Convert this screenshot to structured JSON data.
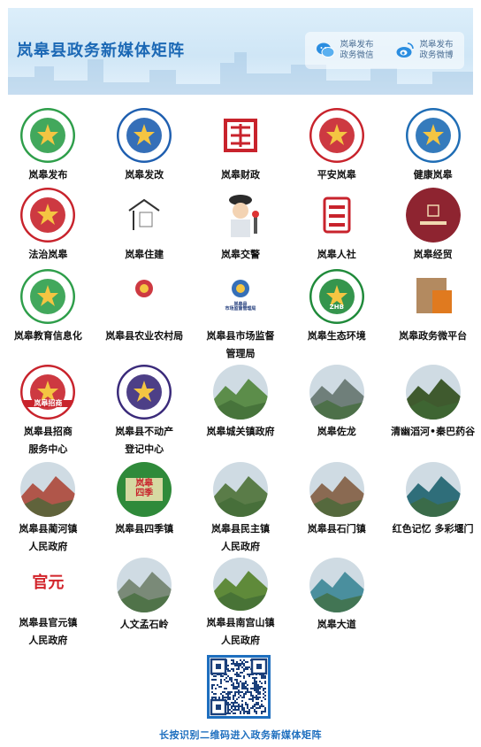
{
  "header": {
    "title": "岚皋县政务新媒体矩阵",
    "links": [
      {
        "line1": "岚皋发布",
        "line2": "政务微信",
        "icon": "wechat-icon"
      },
      {
        "line1": "岚皋发布",
        "line2": "政务微博",
        "icon": "weibo-icon"
      }
    ]
  },
  "accounts": [
    {
      "name": "岚皋发布",
      "icon": "mountain-logo-icon",
      "color": "#2e9e4a"
    },
    {
      "name": "岚皋发改",
      "icon": "national-emblem-icon",
      "color": "#1f5fb0"
    },
    {
      "name": "岚皋财政",
      "icon": "calligraphy-seal-icon",
      "color": "#c8232c"
    },
    {
      "name": "平安岚皋",
      "icon": "police-badge-icon",
      "color": "#c8232c"
    },
    {
      "name": "健康岚皋",
      "icon": "health-emblem-icon",
      "color": "#1f6db5"
    },
    {
      "name": "法治岚皋",
      "icon": "justice-emblem-icon",
      "color": "#c8232c"
    },
    {
      "name": "岚皋住建",
      "icon": "house-logo-icon",
      "color": "#555555"
    },
    {
      "name": "岚皋交警",
      "icon": "traffic-police-icon",
      "color": "#2b2b2b"
    },
    {
      "name": "岚皋人社",
      "icon": "labour-logo-icon",
      "color": "#c8232c"
    },
    {
      "name": "岚皋经贸",
      "icon": "trade-logo-icon",
      "color": "#8e2430"
    },
    {
      "name": "岚皋教育信息化",
      "icon": "education-logo-icon",
      "color": "#2e9e4a"
    },
    {
      "name": "岚皋县农业农村局",
      "icon": "agriculture-logo-icon",
      "color": "#c8232c"
    },
    {
      "name": "岚皋县市场监督\n管理局",
      "icon": "market-supervision-icon",
      "color": "#1f5fb0",
      "subtext": "岚皋县\n市场监督管理局"
    },
    {
      "name": "岚皋生态环境",
      "icon": "zhb-emblem-icon",
      "color": "#1f8a3a",
      "subtext": "ZHB"
    },
    {
      "name": "岚皋政务微平台",
      "icon": "squares-logo-icon",
      "color": "#e07a1f"
    },
    {
      "name": "岚皋县招商\n服务中心",
      "icon": "investment-logo-icon",
      "color": "#c8232c",
      "subtext": "岚皋招商"
    },
    {
      "name": "岚皋县不动产\n登记中心",
      "icon": "real-estate-emblem-icon",
      "color": "#3a2a7a"
    },
    {
      "name": "岚皋城关镇政府",
      "icon": "town-photo-icon",
      "color": "#5c8d4a"
    },
    {
      "name": "岚皋佐龙",
      "icon": "misty-mountain-photo-icon",
      "color": "#6f7f7a"
    },
    {
      "name": "清幽滔河•秦巴药谷",
      "icon": "forest-photo-icon",
      "color": "#3f5a2e"
    },
    {
      "name": "岚皋县蔺河镇\n人民政府",
      "icon": "portrait-photo-icon",
      "color": "#b0564a"
    },
    {
      "name": "岚皋县四季镇",
      "icon": "four-seasons-icon",
      "color": "#2d7a34",
      "subtext": "岚皋\n四季"
    },
    {
      "name": "岚皋县民主镇\n人民政府",
      "icon": "valley-photo-icon",
      "color": "#5a7c48"
    },
    {
      "name": "岚皋县石门镇",
      "icon": "village-photo-icon",
      "color": "#8a6a52"
    },
    {
      "name": "红色记忆  多彩堰门",
      "icon": "river-bend-photo-icon",
      "color": "#2f6e7a"
    },
    {
      "name": "岚皋县官元镇\n人民政府",
      "icon": "guanyuan-text-icon",
      "color": "#d2232a",
      "subtext": "官元"
    },
    {
      "name": "人文孟石岭",
      "icon": "road-photo-icon",
      "color": "#7a8a78"
    },
    {
      "name": "岚皋县南宫山镇\n人民政府",
      "icon": "terraces-photo-icon",
      "color": "#5f8a3a"
    },
    {
      "name": "岚皋大道",
      "icon": "lake-photo-icon",
      "color": "#4a8f9e"
    }
  ],
  "footer": {
    "qr_icon": "qr-code-icon",
    "caption": "长按识别二维码进入政务新媒体矩阵"
  }
}
